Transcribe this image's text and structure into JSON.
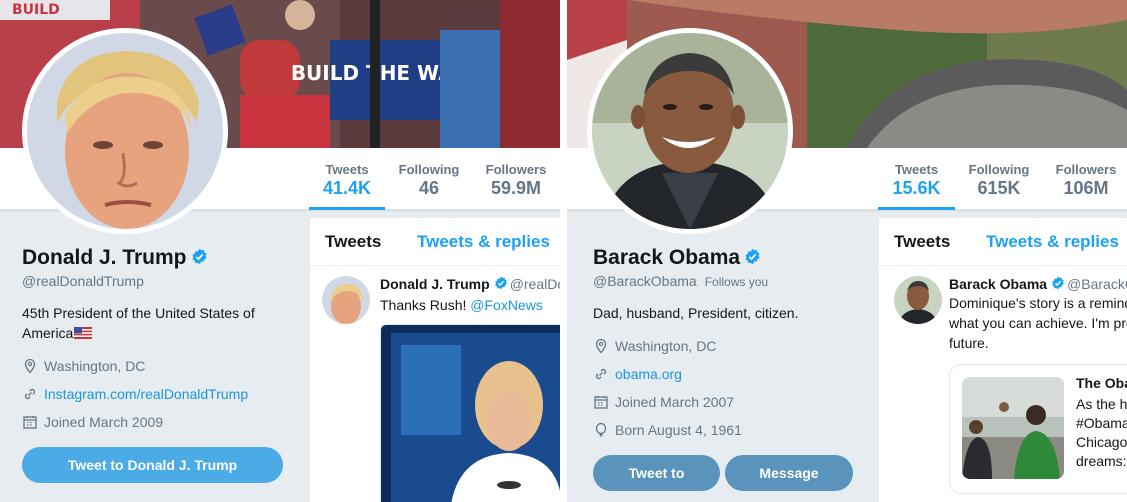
{
  "left": {
    "stats": [
      {
        "label": "Tweets",
        "value": "41.4K"
      },
      {
        "label": "Following",
        "value": "46"
      },
      {
        "label": "Followers",
        "value": "59.9M"
      }
    ],
    "name": "Donald J. Trump",
    "handle": "@realDonaldTrump",
    "bio": "45th President of the United States of America",
    "location": "Washington, DC",
    "website": "Instagram.com/realDonaldTrump",
    "joined": "Joined March 2009",
    "tweet_to_button": "Tweet to Donald J. Trump",
    "banner_sign_text": "BUILD THE WALL",
    "banner_sign_text2": "BUILD",
    "tabs": {
      "tweets": "Tweets",
      "replies": "Tweets & replies"
    },
    "tweet": {
      "name": "Donald J. Trump",
      "handle": "@realDo",
      "text": "Thanks Rush!",
      "link": "@FoxNews"
    }
  },
  "right": {
    "stats": [
      {
        "label": "Tweets",
        "value": "15.6K"
      },
      {
        "label": "Following",
        "value": "615K"
      },
      {
        "label": "Followers",
        "value": "106M"
      }
    ],
    "name": "Barack Obama",
    "handle": "@BarackObama",
    "follows_you": "Follows you",
    "bio": "Dad, husband, President, citizen.",
    "location": "Washington, DC",
    "website": "obama.org",
    "joined": "Joined March 2007",
    "born": "Born August 4, 1961",
    "tweet_to_button": "Tweet to",
    "message_button": "Message",
    "tabs": {
      "tweets": "Tweets",
      "replies": "Tweets & replies"
    },
    "tweet": {
      "name": "Barack Obama",
      "handle": "@BarackO",
      "text_lines": [
        "Dominique's story is a remind",
        "what you can achieve. I'm pro",
        "future."
      ],
      "card_title": "The Oba",
      "card_lines": [
        "As the h",
        "#Obama",
        "Chicago",
        "dreams:"
      ]
    }
  },
  "colors": {
    "accent": "#1da1f2",
    "link": "#1b95e0",
    "muted": "#657786",
    "button": "#4aabe7",
    "button_dark": "#5a94bd"
  }
}
